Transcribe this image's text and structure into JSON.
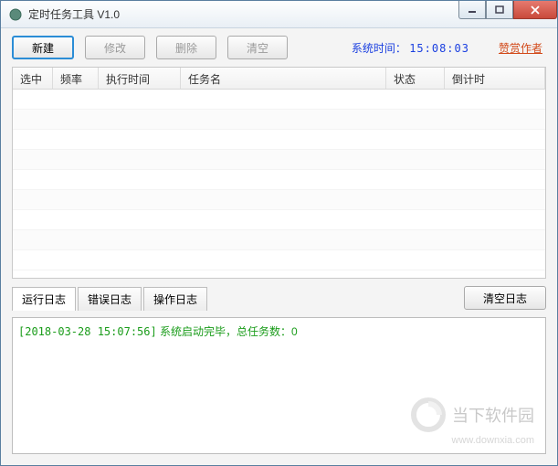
{
  "window": {
    "title": "定时任务工具 V1.0"
  },
  "toolbar": {
    "new_label": "新建",
    "edit_label": "修改",
    "delete_label": "删除",
    "clear_label": "清空",
    "systime_label": "系统时间：",
    "systime_value": "15:08:03",
    "sponsor_label": "赞赏作者"
  },
  "table": {
    "columns": {
      "select": "选中",
      "freq": "频率",
      "exec_time": "执行时间",
      "task_name": "任务名",
      "status": "状态",
      "countdown": "倒计时"
    }
  },
  "logs": {
    "tabs": {
      "run": "运行日志",
      "error": "错误日志",
      "op": "操作日志"
    },
    "clear_label": "清空日志",
    "entry_ts": "[2018-03-28 15:07:56]",
    "entry_msg": " 系统启动完毕，总任务数：0"
  },
  "watermark": {
    "text": "当下软件园",
    "url": "www.downxia.com"
  }
}
